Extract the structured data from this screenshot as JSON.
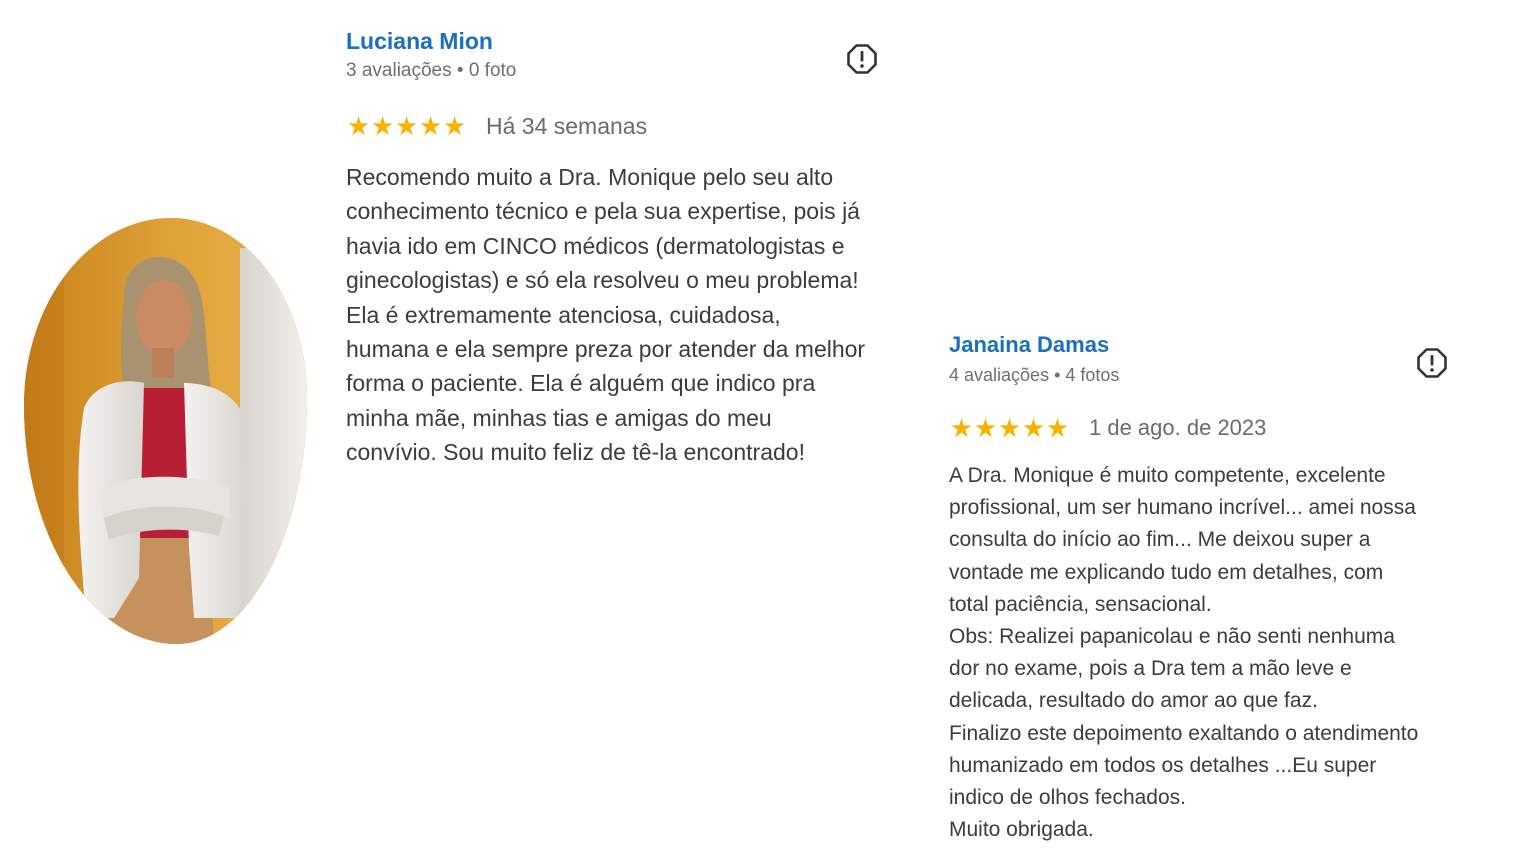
{
  "reviews": [
    {
      "name": "Luciana Mion",
      "meta": "3 avaliações • 0 foto",
      "rating": 5,
      "stars": "★★★★★",
      "date": "Há 34 semanas",
      "text": "Recomendo muito a Dra. Monique pelo seu alto\nconhecimento técnico e pela sua expertise, pois já\nhavia ido em CINCO médicos (dermatologistas e\nginecologistas) e só ela resolveu o meu problema!\nEla é extremamente atenciosa, cuidadosa,\nhumana e ela sempre preza por atender da melhor\nforma o paciente. Ela é alguém que indico pra\nminha mãe, minhas tias e amigas do meu\nconvívio. Sou muito feliz de tê-la encontrado!"
    },
    {
      "name": "Janaina Damas",
      "meta": "4 avaliações • 4 fotos",
      "rating": 5,
      "stars": "★★★★★",
      "date": "1 de ago. de 2023",
      "text": "A Dra. Monique é muito competente, excelente\nprofissional, um ser humano incrível... amei nossa\nconsulta do início ao fim... Me deixou super a\nvontade me explicando tudo em detalhes, com\ntotal paciência, sensacional.\nObs: Realizei papanicolau e não senti nenhuma\ndor no exame, pois a Dra tem a mão leve e\ndelicada, resultado do amor ao que faz.\nFinalizo este depoimento exaltando o atendimento\nhumanizado em todos os detalhes ...Eu super\nindico de olhos fechados.\nMuito obrigada."
    }
  ],
  "icons": {
    "star": "star-icon",
    "report": "report-flag-icon"
  },
  "colors": {
    "name": "#1a6fc1",
    "star": "#f6b400",
    "meta": "#6f6f6f",
    "text": "#3c3c3c",
    "photo_bg": "#d9951f"
  }
}
